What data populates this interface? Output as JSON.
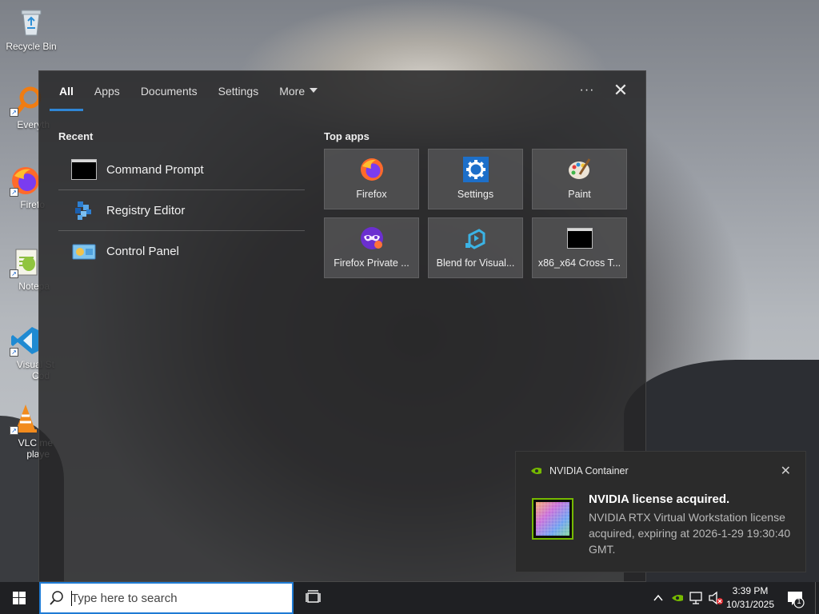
{
  "desktop": {
    "icons": [
      {
        "label": "Recycle Bin",
        "icon": "recycle-bin-icon"
      },
      {
        "label": "Everyth",
        "icon": "everything-search-icon"
      },
      {
        "label": "Firefo",
        "icon": "firefox-icon"
      },
      {
        "label": "Notepa",
        "icon": "notepad-plus-plus-icon"
      },
      {
        "label": "Visual St",
        "label2": "Cod",
        "icon": "vscode-icon"
      },
      {
        "label": "VLC me",
        "label2": "playe",
        "icon": "vlc-icon"
      }
    ]
  },
  "search_panel": {
    "tabs": [
      {
        "label": "All",
        "active": true
      },
      {
        "label": "Apps"
      },
      {
        "label": "Documents"
      },
      {
        "label": "Settings"
      },
      {
        "label": "More",
        "has_dropdown": true
      }
    ],
    "more_options_label": "···",
    "close_label": "✕",
    "recent": {
      "title": "Recent",
      "items": [
        {
          "name": "Command Prompt",
          "icon": "command-prompt-icon"
        },
        {
          "name": "Registry Editor",
          "icon": "registry-editor-icon"
        },
        {
          "name": "Control Panel",
          "icon": "control-panel-icon"
        }
      ]
    },
    "top_apps": {
      "title": "Top apps",
      "items": [
        {
          "name": "Firefox",
          "icon": "firefox-icon"
        },
        {
          "name": "Settings",
          "icon": "settings-gear-icon"
        },
        {
          "name": "Paint",
          "icon": "paint-palette-icon"
        },
        {
          "name": "Firefox Private ...",
          "icon": "firefox-private-icon"
        },
        {
          "name": "Blend for Visual...",
          "icon": "blend-icon"
        },
        {
          "name": "x86_x64 Cross T...",
          "icon": "terminal-icon"
        }
      ]
    }
  },
  "notification": {
    "source": "NVIDIA Container",
    "title": "NVIDIA license acquired.",
    "body": "NVIDIA RTX Virtual Workstation license acquired, expiring at 2026-1-29 19:30:40 GMT.",
    "close_label": "✕"
  },
  "taskbar": {
    "search_placeholder": "Type here to search",
    "clock_time": "3:39 PM",
    "clock_date": "10/31/2025",
    "notification_count": "1",
    "accent_color": "#1f7bd4"
  }
}
